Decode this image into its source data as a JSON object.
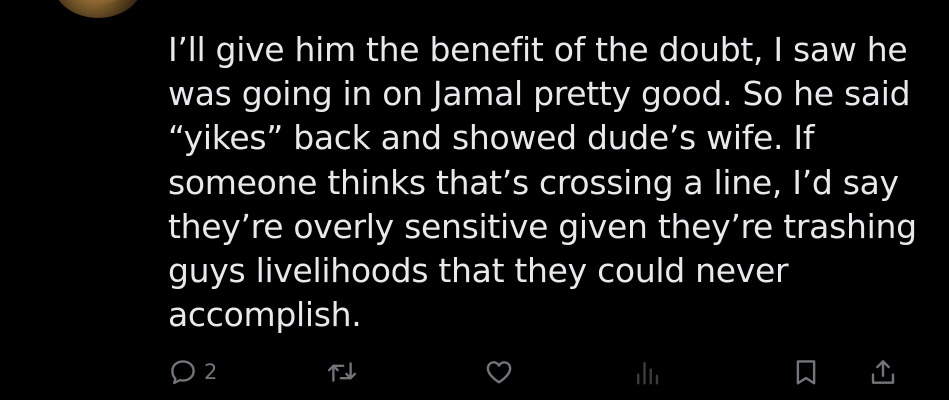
{
  "post": {
    "avatar_icon": "user-avatar",
    "lines": [
      "I’ll give him the benefit of the doubt, I saw he",
      "was going in on Jamal pretty good. So he said",
      "“yikes” back and showed dude’s wife. If",
      "someone thinks that’s crossing a line, I’d say",
      "they’re overly sensitive given they’re trashing",
      "guys livelihoods that they could never",
      "accomplish."
    ]
  },
  "actions": {
    "reply_icon": "reply-bubble-icon",
    "reply_count": "2",
    "repost_icon": "repost-icon",
    "like_icon": "heart-icon",
    "views_icon": "analytics-bars-icon",
    "bookmark_icon": "bookmark-icon",
    "share_icon": "share-upload-icon"
  },
  "colors": {
    "background": "#000000",
    "text": "#e7e9ea",
    "muted": "#71767b"
  }
}
